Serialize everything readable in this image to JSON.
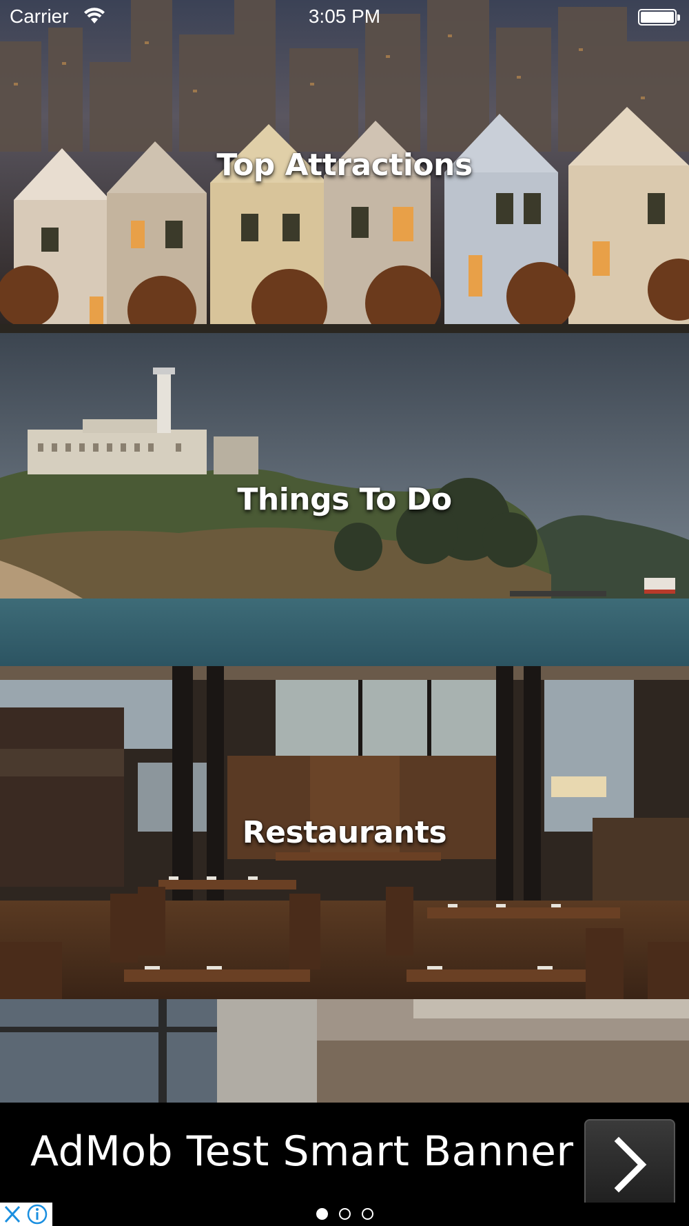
{
  "status_bar": {
    "carrier": "Carrier",
    "time": "3:05 PM"
  },
  "categories": [
    {
      "label": "Top Attractions"
    },
    {
      "label": "Things To Do"
    },
    {
      "label": "Restaurants"
    },
    {
      "label": ""
    }
  ],
  "ad": {
    "text": "AdMob Test Smart Banner",
    "cta_icon": "chevron-right-icon",
    "adchoices_icons": [
      "close-icon",
      "info-icon"
    ]
  },
  "pager": {
    "count": 3,
    "active_index": 0
  },
  "colors": {
    "background": "#000000",
    "text": "#ffffff",
    "adchoices_blue": "#1a8fe0"
  }
}
